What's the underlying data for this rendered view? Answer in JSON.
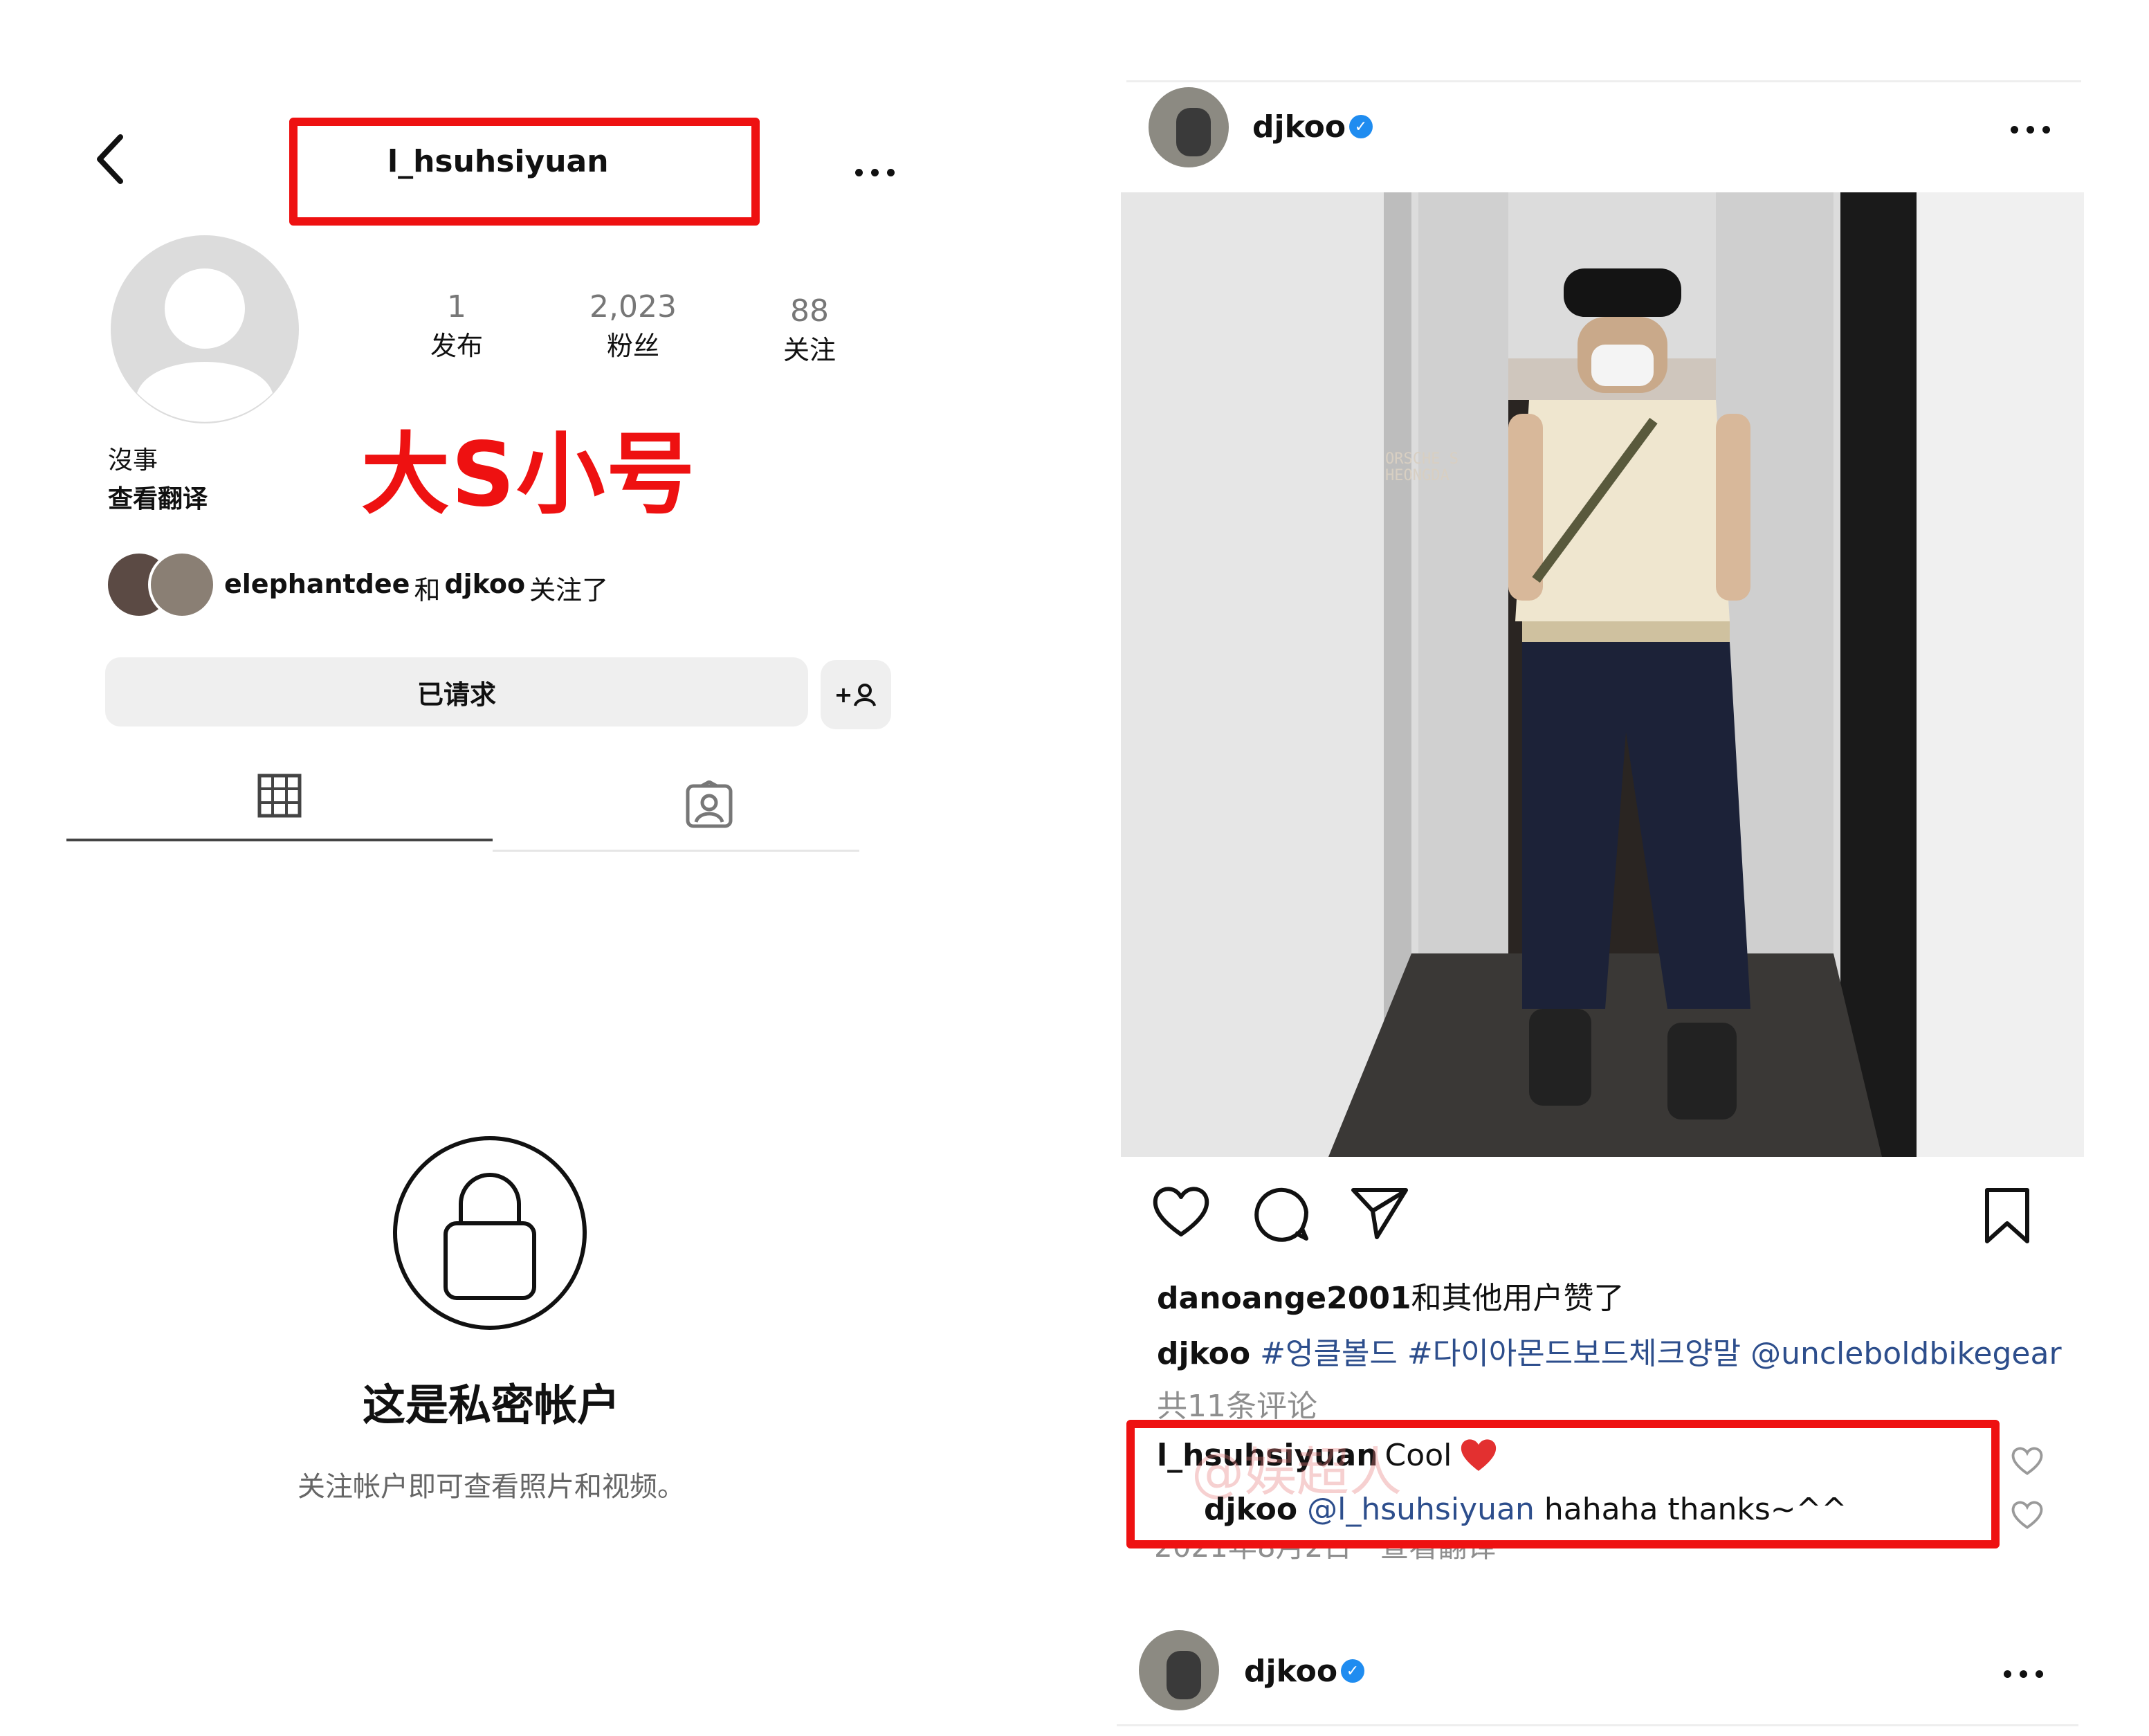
{
  "profile": {
    "username": "l_hsuhsiyuan",
    "stats": [
      {
        "value": "1",
        "label": "发布"
      },
      {
        "value": "2,023",
        "label": "粉丝"
      },
      {
        "value": "88",
        "label": "关注"
      }
    ],
    "bio": "沒事",
    "translate_link": "查看翻译",
    "annotation": "大S小号",
    "followed_by": {
      "name1": "elephantdee",
      "connector": "和",
      "name2": "djkoo",
      "suffix": "关注了"
    },
    "request_button": "已请求",
    "add_friend_label": "+",
    "private_title": "这是私密帐户",
    "private_subtitle": "关注帐户即可查看照片和视频。"
  },
  "post": {
    "author": "djkoo",
    "liked_by": {
      "name": "danoange2001",
      "text": "和其他用户赞了"
    },
    "caption": {
      "author": "djkoo",
      "tag1": "#엉클볼드",
      "tag2": "#다이아몬드보드체크양말",
      "mention": "@uncleboldbikegear"
    },
    "comments_count": "共11条评论",
    "comment": {
      "author": "l_hsuhsiyuan",
      "text": "Cool"
    },
    "reply": {
      "author": "djkoo",
      "mention": "@l_hsuhsiyuan",
      "text": "hahaha thanks~^^"
    },
    "date_partial": "2021年8月2日 · 查看翻译",
    "photo_sign": "ORSCHE S\nHEONGDA",
    "watermark": "@娱超人",
    "next_post_author": "djkoo"
  },
  "colors": {
    "annotation_red": "#ee1111",
    "verified_blue": "#1f8cf0",
    "link_blue": "#2d4e8c"
  }
}
